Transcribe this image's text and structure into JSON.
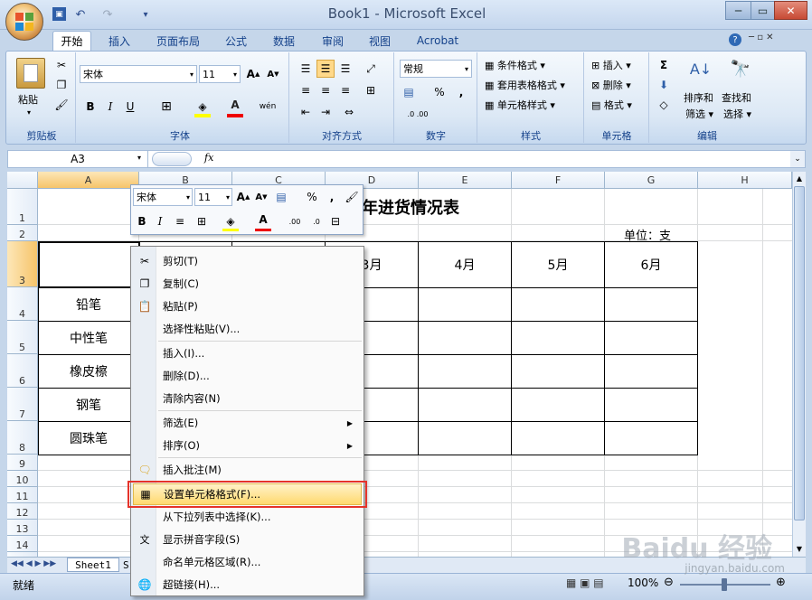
{
  "window": {
    "title": "Book1 - Microsoft Excel",
    "minimize": "─",
    "restore": "▭",
    "close": "✕",
    "qa_undo": "↶",
    "qa_redo": "↷",
    "qa_menu": "▾"
  },
  "tabs": [
    "开始",
    "插入",
    "页面布局",
    "公式",
    "数据",
    "审阅",
    "视图",
    "Acrobat"
  ],
  "ribbon": {
    "clipboard": {
      "paste": "粘贴",
      "label": "剪贴板"
    },
    "font": {
      "name": "宋体",
      "size": "11",
      "bold": "B",
      "italic": "I",
      "underline": "U",
      "fontcolor": "A",
      "phonetic": "wén",
      "label": "字体"
    },
    "align": {
      "label": "对齐方式"
    },
    "number": {
      "format": "常规",
      "percent": "%",
      "comma": ",",
      "inc": ".0 .00",
      "label": "数字"
    },
    "styles": {
      "cond": "条件格式",
      "table": "套用表格格式",
      "cell": "单元格样式",
      "label": "样式"
    },
    "cells": {
      "insert": "插入",
      "delete": "删除",
      "format": "格式",
      "label": "单元格"
    },
    "editing": {
      "sum": "Σ",
      "sort": "排序和",
      "sort2": "筛选",
      "find": "查找和",
      "find2": "选择",
      "label": "编辑"
    }
  },
  "formula_bar": {
    "name_box": "A3",
    "fx": "fx"
  },
  "columns": [
    "A",
    "B",
    "C",
    "D",
    "E",
    "F",
    "G",
    "H"
  ],
  "rows": [
    "1",
    "2",
    "3",
    "4",
    "5",
    "6",
    "7",
    "8",
    "9",
    "10",
    "11",
    "12",
    "13",
    "14"
  ],
  "cells": {
    "title": "年进货情况表",
    "unit": "单位：支",
    "months": [
      "3月",
      "4月",
      "5月",
      "6月"
    ],
    "items": [
      "铅笔",
      "中性笔",
      "橡皮檫",
      "钢笔",
      "圆珠笔"
    ]
  },
  "mini_toolbar": {
    "font": "宋体",
    "size": "11",
    "percent": "%",
    "comma": ",",
    "bold": "B",
    "italic": "I",
    "fontcolor": "A"
  },
  "context_menu": {
    "items": [
      {
        "label": "剪切(T)",
        "icon": "✂"
      },
      {
        "label": "复制(C)",
        "icon": "❐"
      },
      {
        "label": "粘贴(P)",
        "icon": "📋"
      },
      {
        "label": "选择性粘贴(V)...",
        "icon": ""
      },
      {
        "label": "插入(I)...",
        "icon": ""
      },
      {
        "label": "删除(D)...",
        "icon": ""
      },
      {
        "label": "清除内容(N)",
        "icon": ""
      },
      {
        "label": "筛选(E)",
        "icon": ""
      },
      {
        "label": "排序(O)",
        "icon": ""
      },
      {
        "label": "插入批注(M)",
        "icon": "🗨"
      },
      {
        "label": "设置单元格格式(F)...",
        "icon": "▦"
      },
      {
        "label": "从下拉列表中选择(K)...",
        "icon": ""
      },
      {
        "label": "显示拼音字段(S)",
        "icon": "文"
      },
      {
        "label": "命名单元格区域(R)...",
        "icon": ""
      },
      {
        "label": "超链接(H)...",
        "icon": "🌐"
      }
    ],
    "submenu_arrow": "▶"
  },
  "sheet_tabs": {
    "sheet1": "Sheet1",
    "sheet2": "S"
  },
  "status": {
    "ready": "就绪",
    "zoom": "100%",
    "zoom_minus": "⊖",
    "zoom_plus": "⊕"
  },
  "watermark": {
    "main": "Baidu 经验",
    "sub": "jingyan.baidu.com"
  },
  "colors": {
    "accent": "#15428b",
    "highlight": "#ffd96f",
    "redbox": "#e5332a"
  }
}
